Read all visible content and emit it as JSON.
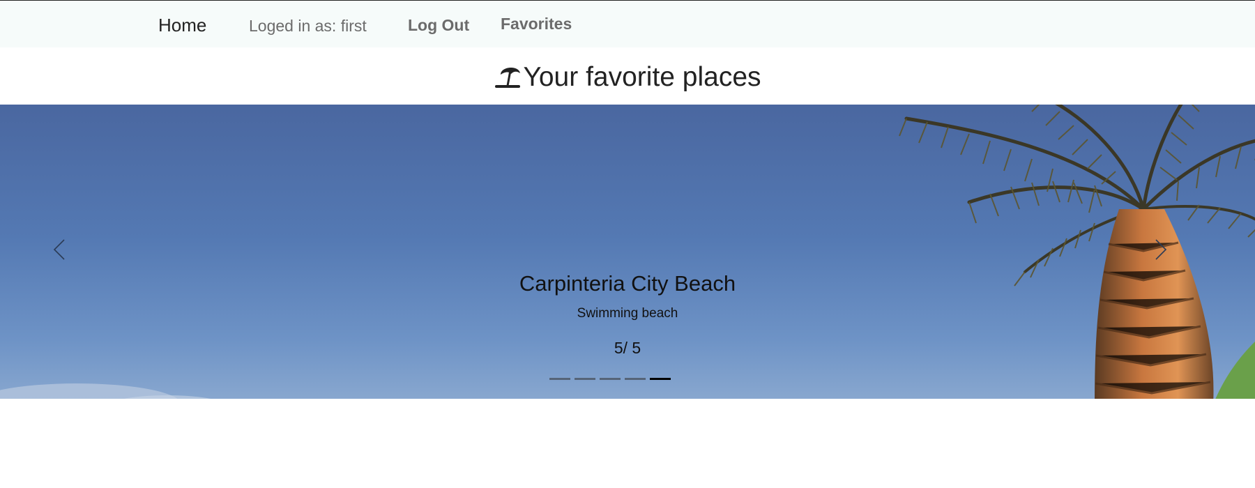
{
  "nav": {
    "brand": "Home",
    "user_status": "Loged in as: first",
    "logout": "Log Out",
    "favorites": "Favorites"
  },
  "page": {
    "title": "Your favorite places",
    "title_icon": "beach-umbrella-icon"
  },
  "carousel": {
    "slide_title": "Carpinteria City Beach",
    "slide_subtitle": "Swimming beach",
    "counter": "5/ 5",
    "current_index": 5,
    "total": 5,
    "prev_icon": "chevron-left-icon",
    "next_icon": "chevron-right-icon"
  },
  "colors": {
    "navbar_bg": "#f6fbfa",
    "sky": "#5479b3",
    "text_dark": "#222222",
    "nav_muted": "#6b6b6b"
  }
}
